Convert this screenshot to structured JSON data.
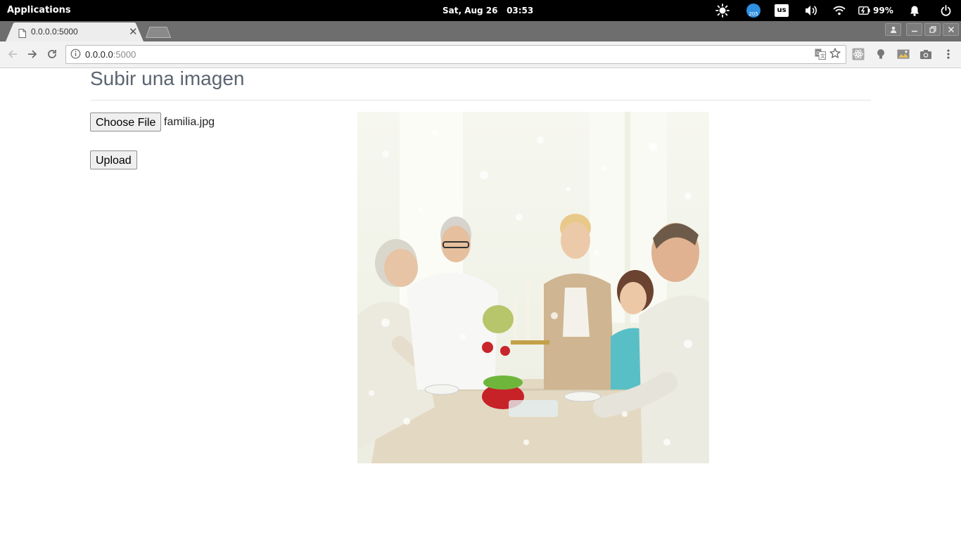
{
  "system_bar": {
    "applications": "Applications",
    "date": "Sat, Aug 26",
    "time": "03:53",
    "weather_badge": "205",
    "keyboard_layout": "us",
    "battery": "99%"
  },
  "browser": {
    "tab_title": "0.0.0.0:5000",
    "url_host": "0.0.0.0",
    "url_port": ":5000"
  },
  "page": {
    "heading": "Subir una imagen",
    "choose_file_label": "Choose File",
    "file_name": "familia.jpg",
    "upload_label": "Upload"
  },
  "colors": {
    "system_bar": "#000000",
    "tab_strip": "#6e6e6e",
    "toolbar": "#f2f2f2",
    "heading": "#5b6570"
  }
}
